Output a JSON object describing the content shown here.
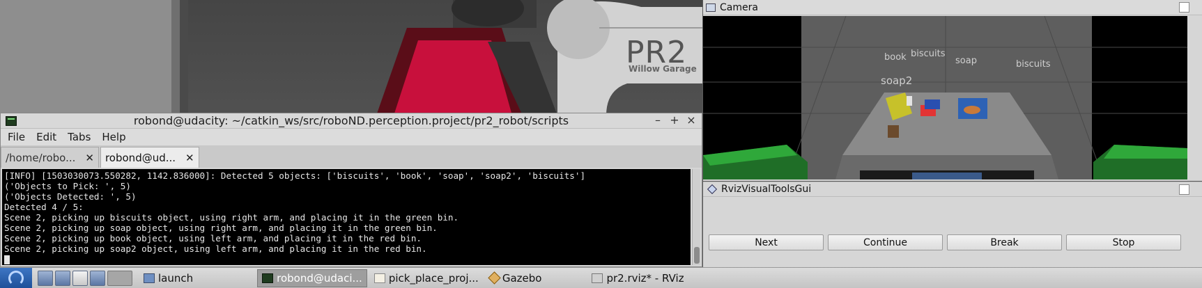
{
  "gazebo": {
    "robot_logo": "PR2",
    "robot_brand": "Willow Garage"
  },
  "terminal": {
    "title": "robond@udacity: ~/catkin_ws/src/roboND.perception.project/pr2_robot/scripts",
    "menu": [
      "File",
      "Edit",
      "Tabs",
      "Help"
    ],
    "tabs": [
      {
        "label": "/home/robo..."
      },
      {
        "label": "robond@ud..."
      }
    ],
    "lines": [
      "[INFO] [1503030073.550282, 1142.836000]: Detected 5 objects: ['biscuits', 'book', 'soap', 'soap2', 'biscuits']",
      "('Objects to Pick:  ', 5)",
      "('Objects Detected: ', 5)",
      "Detected 4 / 5:",
      "Scene 2, picking up biscuits object, using right arm, and placing it in the green bin.",
      "Scene 2, picking up soap object, using right arm, and placing it in the green bin.",
      "Scene 2, picking up book object, using left arm, and placing it in the red bin.",
      "Scene 2, picking up soap2 object, using left arm, and placing it in the red bin."
    ]
  },
  "camera": {
    "title": "Camera",
    "labels": [
      "book",
      "biscuits",
      "soap",
      "biscuits",
      "soap2"
    ]
  },
  "rviz_tools": {
    "title": "RvizVisualToolsGui",
    "buttons": [
      "Next",
      "Continue",
      "Break",
      "Stop"
    ]
  },
  "taskbar": {
    "tasks": [
      {
        "label": "launch",
        "icon": "folder-icon"
      },
      {
        "label": "robond@udaci...",
        "icon": "terminal-icon"
      },
      {
        "label": "pick_place_proj...",
        "icon": "document-icon"
      },
      {
        "label": "Gazebo",
        "icon": "gazebo-icon"
      },
      {
        "label": "pr2.rviz* - RViz",
        "icon": "rviz-icon"
      }
    ]
  },
  "colors": {
    "terminal_bg": "#000000",
    "green_bin": "#2fa83a",
    "red_bin": "#c8103c"
  }
}
